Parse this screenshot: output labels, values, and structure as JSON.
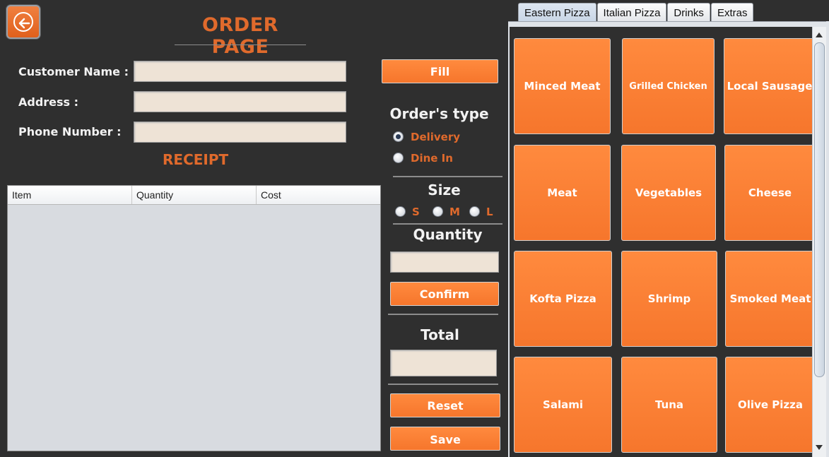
{
  "header": {
    "title": "ORDER PAGE"
  },
  "form": {
    "customer_name_label": "Customer Name :",
    "address_label": "Address :",
    "phone_label": "Phone Number :",
    "customer_name_value": "",
    "address_value": "",
    "phone_value": ""
  },
  "receipt": {
    "title": "RECEIPT",
    "columns": [
      "Item",
      "Quantity",
      "Cost"
    ],
    "rows": []
  },
  "controls": {
    "fill_label": "Fill",
    "order_type_title": "Order's type",
    "order_types": [
      {
        "label": "Delivery",
        "checked": true
      },
      {
        "label": "Dine In",
        "checked": false
      }
    ],
    "size_title": "Size",
    "sizes": [
      {
        "label": "S",
        "checked": false
      },
      {
        "label": "M",
        "checked": false
      },
      {
        "label": "L",
        "checked": false
      }
    ],
    "quantity_title": "Quantity",
    "quantity_value": "",
    "confirm_label": "Confirm",
    "total_title": "Total",
    "total_value": "",
    "reset_label": "Reset",
    "save_label": "Save"
  },
  "menu": {
    "tabs": [
      {
        "label": "Eastern Pizza",
        "active": true
      },
      {
        "label": "Italian Pizza",
        "active": false
      },
      {
        "label": "Drinks",
        "active": false
      },
      {
        "label": "Extras",
        "active": false
      }
    ],
    "items": [
      "Minced Meat",
      "Grilled Chicken",
      "Local Sausage",
      "Meat",
      "Vegetables",
      "Cheese",
      "Kofta Pizza",
      "Shrimp",
      "Smoked Meat",
      "Salami",
      "Tuna",
      "Olive Pizza"
    ]
  },
  "icons": {
    "back": "back-arrow-icon"
  },
  "colors": {
    "accent": "#f6762c",
    "title": "#e06a2c",
    "background": "#2f2f2f",
    "field": "#eee3d6"
  }
}
